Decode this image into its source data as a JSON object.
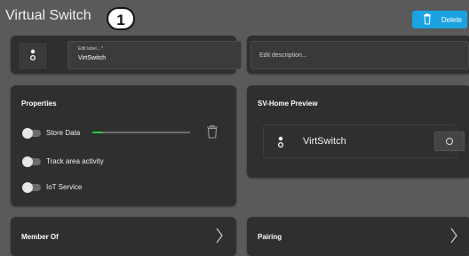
{
  "app": {
    "title": "Virtual Switch",
    "step_badge": "1",
    "delete_label": "Delete"
  },
  "label_field": {
    "caption": "Edit label... *",
    "value": "VirtSwitch",
    "icon": "device-switch-icon"
  },
  "description_field": {
    "placeholder": "Edit description..."
  },
  "properties": {
    "title": "Properties",
    "rows": [
      {
        "label": "Store Data",
        "enabled": false
      },
      {
        "label": "Track area activity",
        "enabled": false
      },
      {
        "label": "IoT Service",
        "enabled": false
      }
    ],
    "store_slider_level": 0.1,
    "icons": {
      "trash": "trash-icon"
    }
  },
  "preview": {
    "title": "SV-Home Preview",
    "device_name": "VirtSwitch"
  },
  "member_of": {
    "title": "Member Of"
  },
  "pairing": {
    "title": "Pairing"
  },
  "colors": {
    "background": "#5a5a5a",
    "card": "#2f2f2f",
    "accent": "#1aa3e0",
    "slider_fill": "#2ecc40"
  }
}
